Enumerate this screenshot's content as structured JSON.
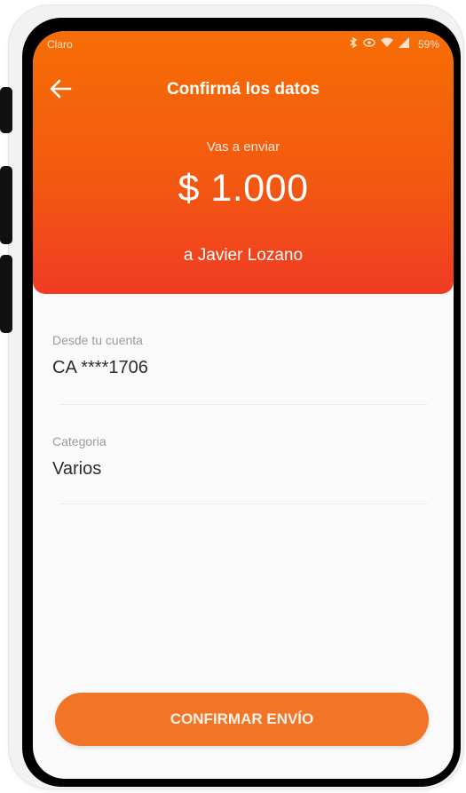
{
  "status_bar": {
    "carrier": "Claro",
    "battery": "59%",
    "icons": [
      "bluetooth-icon",
      "eye-icon",
      "wifi-icon",
      "signal-icon"
    ]
  },
  "header": {
    "back_icon": "arrow-left-icon",
    "title": "Confirmá los datos",
    "subtitle": "Vas a enviar",
    "amount": "$ 1.000",
    "recipient": "a Javier Lozano"
  },
  "details": [
    {
      "label": "Desde tu cuenta",
      "value": "CA ****1706"
    },
    {
      "label": "Categoria",
      "value": "Varios"
    }
  ],
  "actions": {
    "confirm_label": "CONFIRMAR ENVÍO"
  },
  "colors": {
    "header_top": "#f66d05",
    "header_bottom": "#f03b24",
    "button": "#f27426"
  }
}
